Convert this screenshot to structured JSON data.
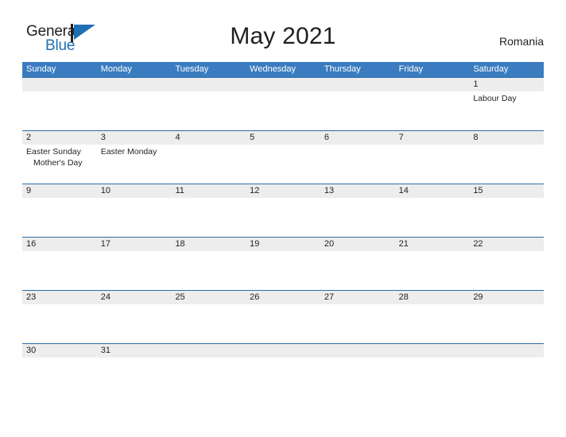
{
  "brand": {
    "name_part1": "General",
    "name_part2": "Blue",
    "mark": "triangle-flag-logo"
  },
  "header": {
    "title": "May 2021",
    "locale": "Romania"
  },
  "colors": {
    "header_blue": "#3b7cc0",
    "row_rule_blue": "#2f6ba8",
    "band_gray": "#ededed",
    "brand_blue": "#1f6fb4",
    "text": "#231f20"
  },
  "calendar": {
    "month": "May",
    "year": "2021",
    "weekday_headers": [
      "Sunday",
      "Monday",
      "Tuesday",
      "Wednesday",
      "Thursday",
      "Friday",
      "Saturday"
    ],
    "weeks": [
      {
        "days": [
          {
            "num": "",
            "events": []
          },
          {
            "num": "",
            "events": []
          },
          {
            "num": "",
            "events": []
          },
          {
            "num": "",
            "events": []
          },
          {
            "num": "",
            "events": []
          },
          {
            "num": "",
            "events": []
          },
          {
            "num": "1",
            "events": [
              {
                "label": "Labour Day",
                "indent": false
              }
            ]
          }
        ]
      },
      {
        "days": [
          {
            "num": "2",
            "events": [
              {
                "label": "Easter Sunday",
                "indent": false
              },
              {
                "label": "Mother's Day",
                "indent": true
              }
            ]
          },
          {
            "num": "3",
            "events": [
              {
                "label": "Easter Monday",
                "indent": false
              }
            ]
          },
          {
            "num": "4",
            "events": []
          },
          {
            "num": "5",
            "events": []
          },
          {
            "num": "6",
            "events": []
          },
          {
            "num": "7",
            "events": []
          },
          {
            "num": "8",
            "events": []
          }
        ]
      },
      {
        "days": [
          {
            "num": "9",
            "events": []
          },
          {
            "num": "10",
            "events": []
          },
          {
            "num": "11",
            "events": []
          },
          {
            "num": "12",
            "events": []
          },
          {
            "num": "13",
            "events": []
          },
          {
            "num": "14",
            "events": []
          },
          {
            "num": "15",
            "events": []
          }
        ]
      },
      {
        "days": [
          {
            "num": "16",
            "events": []
          },
          {
            "num": "17",
            "events": []
          },
          {
            "num": "18",
            "events": []
          },
          {
            "num": "19",
            "events": []
          },
          {
            "num": "20",
            "events": []
          },
          {
            "num": "21",
            "events": []
          },
          {
            "num": "22",
            "events": []
          }
        ]
      },
      {
        "days": [
          {
            "num": "23",
            "events": []
          },
          {
            "num": "24",
            "events": []
          },
          {
            "num": "25",
            "events": []
          },
          {
            "num": "26",
            "events": []
          },
          {
            "num": "27",
            "events": []
          },
          {
            "num": "28",
            "events": []
          },
          {
            "num": "29",
            "events": []
          }
        ]
      },
      {
        "last": true,
        "days": [
          {
            "num": "30",
            "events": []
          },
          {
            "num": "31",
            "events": []
          },
          {
            "num": "",
            "events": []
          },
          {
            "num": "",
            "events": []
          },
          {
            "num": "",
            "events": []
          },
          {
            "num": "",
            "events": []
          },
          {
            "num": "",
            "events": []
          }
        ]
      }
    ]
  }
}
